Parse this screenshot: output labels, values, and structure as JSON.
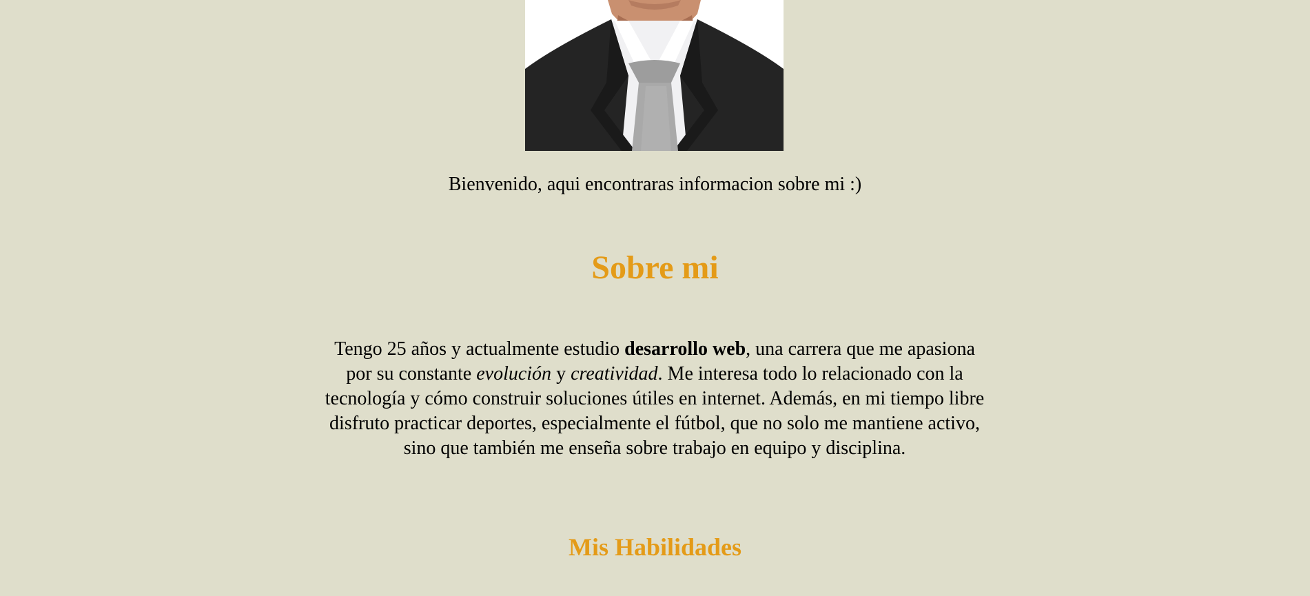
{
  "profile": {
    "image_alt": "Foto de perfil"
  },
  "welcome_text": "Bienvenido, aqui encontraras informacion sobre mi :)",
  "about": {
    "title": "Sobre mi",
    "p1": "Tengo 25 años y actualmente estudio ",
    "strong1": "desarrollo web",
    "p2": ", una carrera que me apasiona por su constante ",
    "em1": "evolución",
    "p3": " y ",
    "em2": "creatividad",
    "p4": ". Me interesa todo lo relacionado con la tecnología y cómo construir soluciones útiles en internet. Además, en mi tiempo libre disfruto practicar deportes, especialmente el fútbol, que no solo me mantiene activo, sino que también me enseña sobre trabajo en equipo y disciplina."
  },
  "skills": {
    "title": "Mis Habilidades"
  },
  "colors": {
    "background": "#dfdecb",
    "accent": "#e49b18",
    "text": "#000000"
  }
}
